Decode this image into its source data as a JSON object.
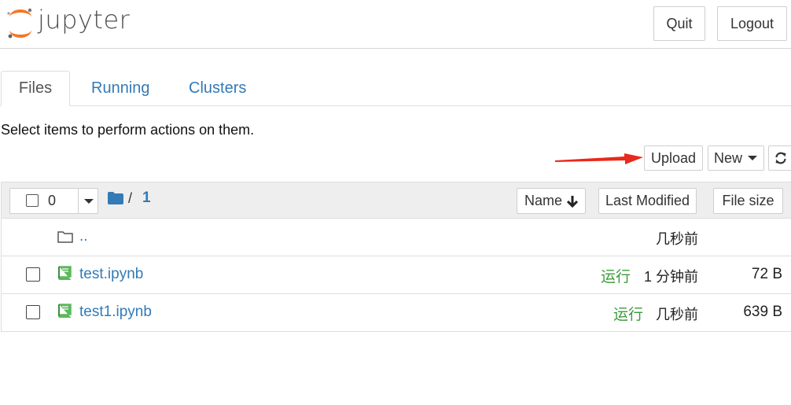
{
  "header": {
    "logo_text": "jupyter",
    "quit_label": "Quit",
    "logout_label": "Logout"
  },
  "tabs": [
    {
      "label": "Files",
      "active": true
    },
    {
      "label": "Running",
      "active": false
    },
    {
      "label": "Clusters",
      "active": false
    }
  ],
  "hint": "Select items to perform actions on them.",
  "toolbar": {
    "upload_label": "Upload",
    "new_label": "New",
    "refresh_icon": "refresh-icon"
  },
  "list_header": {
    "selected_count": "0",
    "breadcrumb_separator": "/",
    "breadcrumb_current": "1",
    "sort_name_label": "Name",
    "sort_modified_label": "Last Modified",
    "sort_size_label": "File size"
  },
  "rows": [
    {
      "name": "..",
      "type": "folder",
      "status": "",
      "modified": "几秒前",
      "size": ""
    },
    {
      "name": "test.ipynb",
      "type": "notebook",
      "status": "运行",
      "modified": "1 分钟前",
      "size": "72 B"
    },
    {
      "name": "test1.ipynb",
      "type": "notebook",
      "status": "运行",
      "modified": "几秒前",
      "size": "639 B"
    }
  ],
  "colors": {
    "link": "#337ab7",
    "running": "#3c9b3c",
    "logo_orange": "#f37726",
    "arrow": "#e8291c"
  }
}
